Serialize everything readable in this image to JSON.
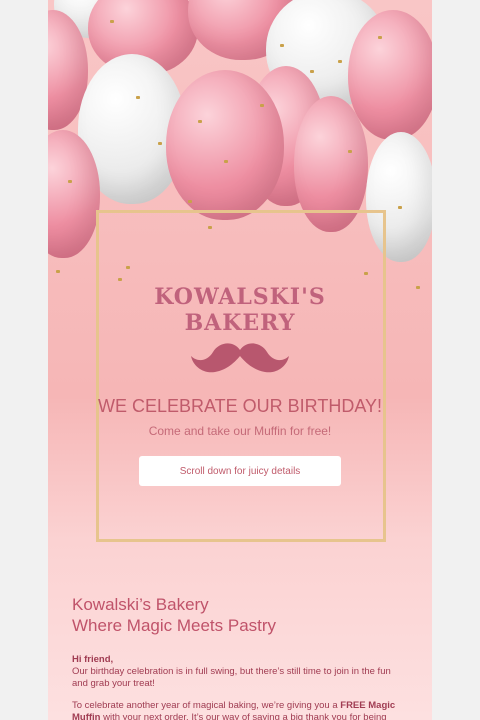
{
  "colors": {
    "accent": "#c05b6b",
    "frame_gold": "#e7c48d",
    "background_pink": "#f7bcbc"
  },
  "hero": {
    "logo_line1": "KOWALSKI'S",
    "logo_line2": "BAKERY",
    "logo_icon": "mustache-icon",
    "headline": "WE CELEBRATE OUR BIRTHDAY!",
    "subline": "Come and take our Muffin for free!",
    "cta_label": "Scroll down for juicy details"
  },
  "section": {
    "brand_line1": "Kowalski’s Bakery",
    "brand_line2": "Where Magic Meets Pastry",
    "greeting": "Hi friend,",
    "paragraph1": "Our birthday celebration is in full swing, but there’s still time to join in the fun and grab your treat!",
    "paragraph2_start": "To celebrate another year of magical baking, we’re giving you a ",
    "paragraph2_bold": "FREE Magic Muffin",
    "paragraph2_end": " with your next order. It’s our way of saying a big thank you for being"
  }
}
